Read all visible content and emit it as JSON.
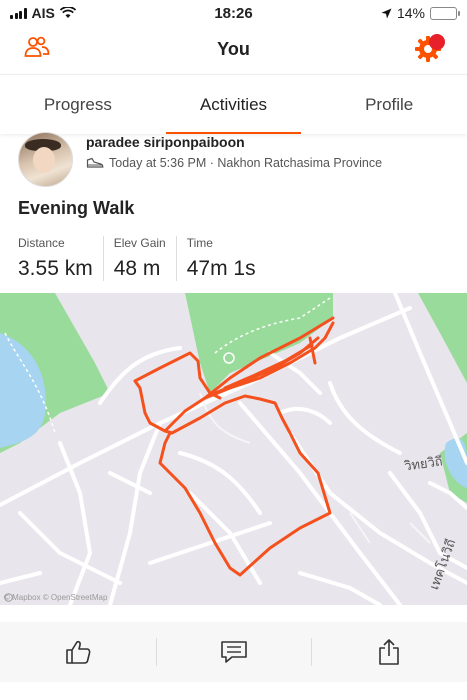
{
  "status_bar": {
    "carrier": "AIS",
    "time": "18:26",
    "battery": "14%"
  },
  "header": {
    "title": "You"
  },
  "tabs": [
    {
      "label": "Progress"
    },
    {
      "label": "Activities",
      "active": true
    },
    {
      "label": "Profile"
    }
  ],
  "activity": {
    "athlete": "paradee siriponpaiboon",
    "meta": "Today at 5:36 PM · Nakhon Ratchasima Province",
    "title": "Evening Walk",
    "stats": [
      {
        "label": "Distance",
        "value": "3.55 km"
      },
      {
        "label": "Elev Gain",
        "value": "48 m"
      },
      {
        "label": "Time",
        "value": "47m 1s"
      }
    ]
  },
  "map": {
    "road_labels": [
      "วิทยวิถี",
      "เทคโนวิถี"
    ],
    "attribution": "© Mapbox © OpenStreetMap"
  },
  "colors": {
    "accent": "#fc5200",
    "route": "#f4511e",
    "water": "#a7d4f0",
    "park": "#99db9a",
    "notification": "#e8202a"
  },
  "icons": [
    "signal-icon",
    "wifi-icon",
    "location-arrow-icon",
    "battery-icon",
    "friends-icon",
    "gear-icon",
    "shoe-icon",
    "kudos-icon",
    "comment-icon",
    "share-icon"
  ]
}
